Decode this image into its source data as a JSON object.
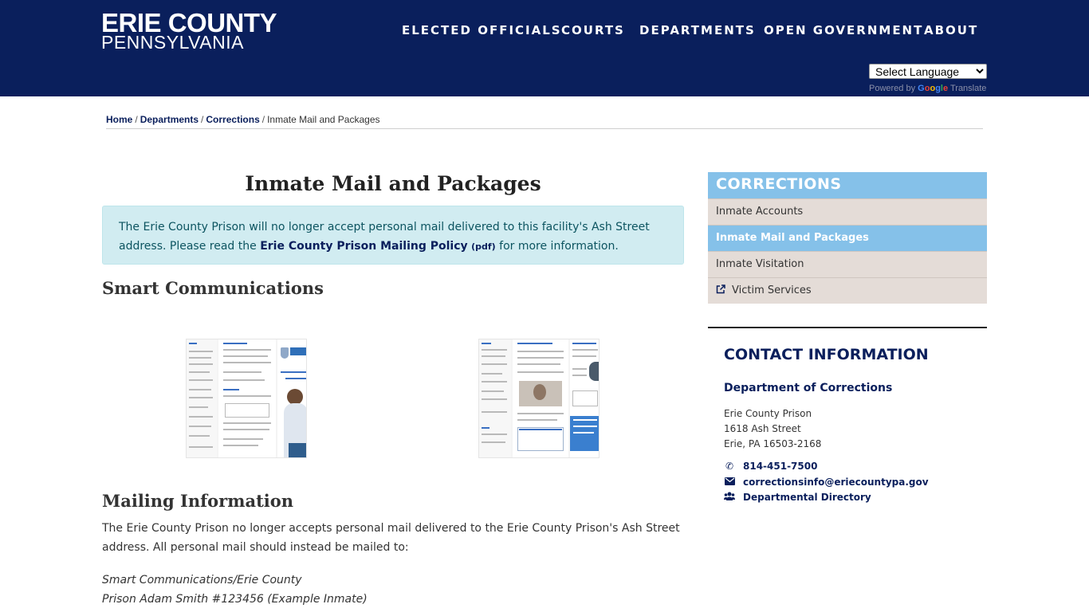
{
  "header": {
    "logo_top": "ERIE COUNTY",
    "logo_bottom": "PENNSYLVANIA",
    "nav": [
      "ELECTED OFFICIALS",
      "COURTS",
      "DEPARTMENTS",
      "OPEN GOVERNMENT",
      "ABOUT"
    ],
    "language_select": "Select Language",
    "powered_by": "Powered by",
    "google": "Google",
    "translate": "Translate"
  },
  "breadcrumb": {
    "items": [
      "Home",
      "Departments",
      "Corrections"
    ],
    "current": "Inmate Mail and Packages",
    "separator": "/"
  },
  "main": {
    "title": "Inmate Mail and Packages",
    "alert_text_1": "The Erie County Prison will no longer accept personal mail delivered to this facility's Ash Street address. Please read the ",
    "alert_link": "Erie County Prison Mailing Policy",
    "alert_pdf": "(pdf)",
    "alert_text_2": " for more information.",
    "section_smart": "Smart Communications",
    "section_mailing": "Mailing Information",
    "mailing_text": "The Erie County Prison no longer accepts personal mail delivered to the Erie County Prison's Ash Street address. All personal mail should instead be mailed to:",
    "address_line_1": "Smart Communications/Erie County",
    "address_line_2": "Prison  Adam Smith #123456 (Example Inmate)"
  },
  "sidebar": {
    "heading": "CORRECTIONS",
    "items": [
      {
        "label": "Inmate Accounts",
        "active": false
      },
      {
        "label": "Inmate Mail and Packages",
        "active": true
      },
      {
        "label": "Inmate Visitation",
        "active": false
      },
      {
        "label": "Victim Services",
        "active": false,
        "icon": "external-link-icon"
      }
    ]
  },
  "contact": {
    "title": "CONTACT INFORMATION",
    "department": "Department of Corrections",
    "address": [
      "Erie County Prison",
      "1618 Ash Street",
      "Erie, PA 16503-2168"
    ],
    "phone": "814-451-7500",
    "email": "correctionsinfo@eriecountypa.gov",
    "directory": "Departmental Directory"
  },
  "colors": {
    "header_bg": "#0a1f5c",
    "accent": "#85c1e9",
    "alert_bg": "#d1ecf1",
    "sidebar_item_bg": "#e4dcd7"
  }
}
